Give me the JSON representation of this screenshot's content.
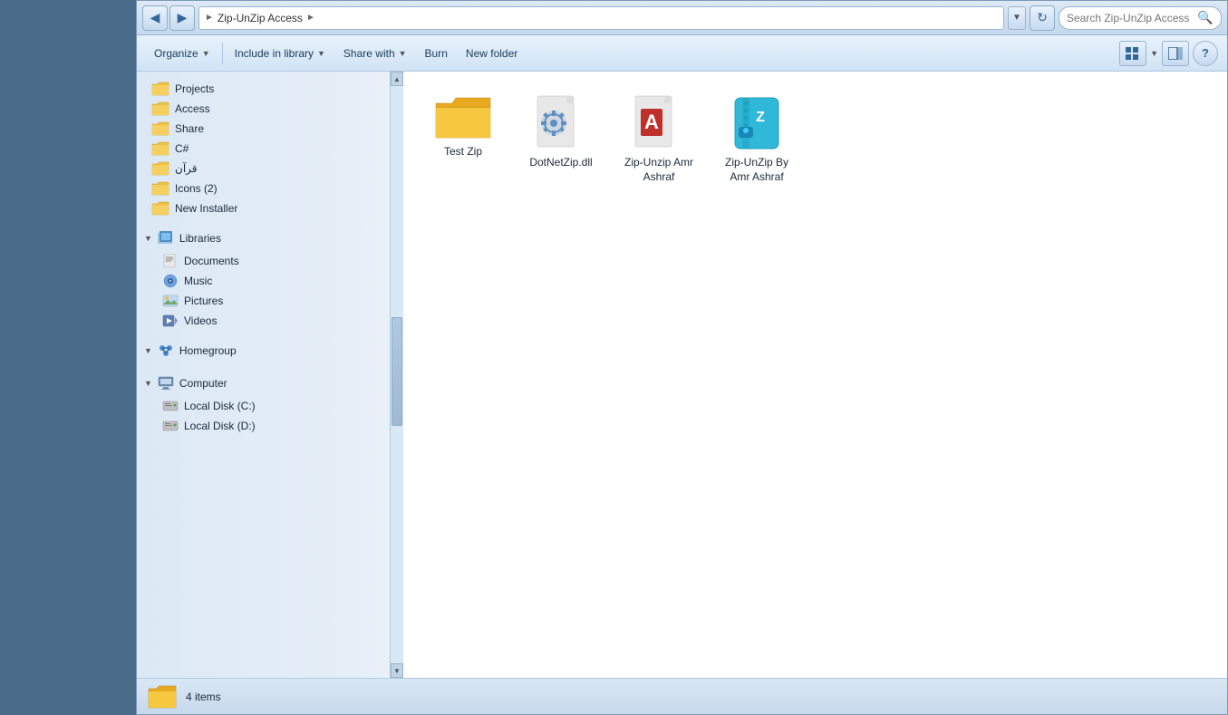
{
  "window": {
    "title": "Zip-UnZip Access"
  },
  "addressBar": {
    "backButton": "◀",
    "forwardButton": "▶",
    "pathLabel": "Zip-UnZip Access",
    "pathArrow": "▶",
    "dropdownArrow": "▼",
    "refreshIcon": "↻",
    "searchPlaceholder": "Search Zip-UnZip Access"
  },
  "toolbar": {
    "organizeLabel": "Organize",
    "includeInLibraryLabel": "Include in library",
    "shareWithLabel": "Share with",
    "burnLabel": "Burn",
    "newFolderLabel": "New folder",
    "dropdownArrow": "▼",
    "helpLabel": "?"
  },
  "sidebar": {
    "folders": [
      {
        "label": "Projects"
      },
      {
        "label": "Access"
      },
      {
        "label": "Share"
      },
      {
        "label": "C#"
      },
      {
        "label": "قرآن"
      },
      {
        "label": "Icons (2)"
      },
      {
        "label": "New Installer"
      }
    ],
    "libraries": {
      "label": "Libraries",
      "items": [
        {
          "label": "Documents"
        },
        {
          "label": "Music"
        },
        {
          "label": "Pictures"
        },
        {
          "label": "Videos"
        }
      ]
    },
    "homegroup": {
      "label": "Homegroup"
    },
    "computer": {
      "label": "Computer",
      "drives": [
        {
          "label": "Local Disk (C:)"
        },
        {
          "label": "Local Disk (D:)"
        }
      ]
    }
  },
  "files": [
    {
      "name": "Test Zip",
      "type": "folder"
    },
    {
      "name": "DotNetZip.dll",
      "type": "dll"
    },
    {
      "name": "Zip-Unzip Amr Ashraf",
      "type": "access"
    },
    {
      "name": "Zip-UnZip By Amr Ashraf",
      "type": "zip-app"
    }
  ],
  "statusBar": {
    "itemCount": "4 items"
  }
}
